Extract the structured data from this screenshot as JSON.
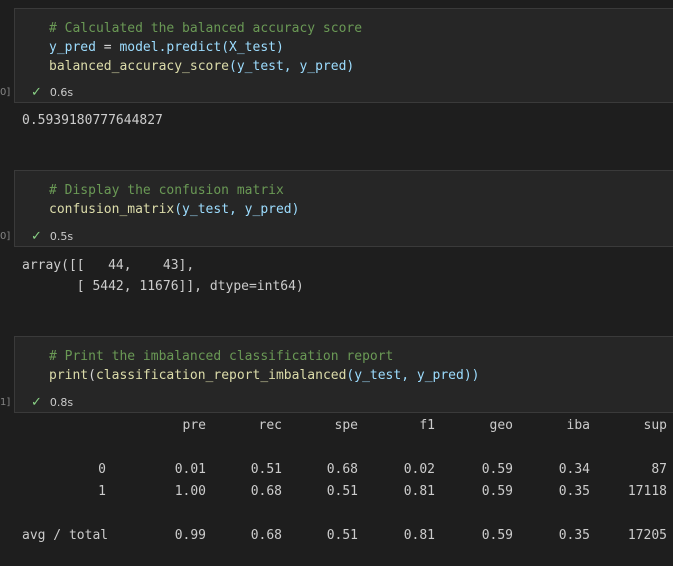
{
  "cells": [
    {
      "comment": "# Calculated the balanced accuracy score",
      "line1_var": "y_pred",
      "line1_eq": " = ",
      "line1_rest": "model.predict(X_test)",
      "line2_fn": "balanced_accuracy_score",
      "line2_args": "(y_test, y_pred)",
      "status_time": "0.6s",
      "gutter": "0]",
      "output": "0.5939180777644827"
    },
    {
      "comment": "# Display the confusion matrix",
      "line1_fn": "confusion_matrix",
      "line1_args": "(y_test, y_pred)",
      "status_time": "0.5s",
      "gutter": "0]",
      "output_line1": "array([[   44,    43],",
      "output_line2": "       [ 5442, 11676]], dtype=int64)"
    },
    {
      "comment": "# Print the imbalanced classification report",
      "line1_fn": "print",
      "line1_open": "(",
      "line1_fn2": "classification_report_imbalanced",
      "line1_args": "(y_test, y_pred))",
      "status_time": "0.8s",
      "gutter": "1]"
    }
  ],
  "report": {
    "headers": [
      "pre",
      "rec",
      "spe",
      "f1",
      "geo",
      "iba",
      "sup"
    ],
    "rows": [
      {
        "label": "0",
        "values": [
          "0.01",
          "0.51",
          "0.68",
          "0.02",
          "0.59",
          "0.34",
          "87"
        ]
      },
      {
        "label": "1",
        "values": [
          "1.00",
          "0.68",
          "0.51",
          "0.81",
          "0.59",
          "0.35",
          "17118"
        ]
      },
      {
        "label": "avg / total",
        "values": [
          "0.99",
          "0.68",
          "0.51",
          "0.81",
          "0.59",
          "0.35",
          "17205"
        ]
      }
    ]
  },
  "colors": {
    "check": "#89d185",
    "comment": "#6a9955",
    "variable": "#9cdcfe",
    "function": "#dcdcaa"
  },
  "icons": {
    "status": "check-icon"
  }
}
